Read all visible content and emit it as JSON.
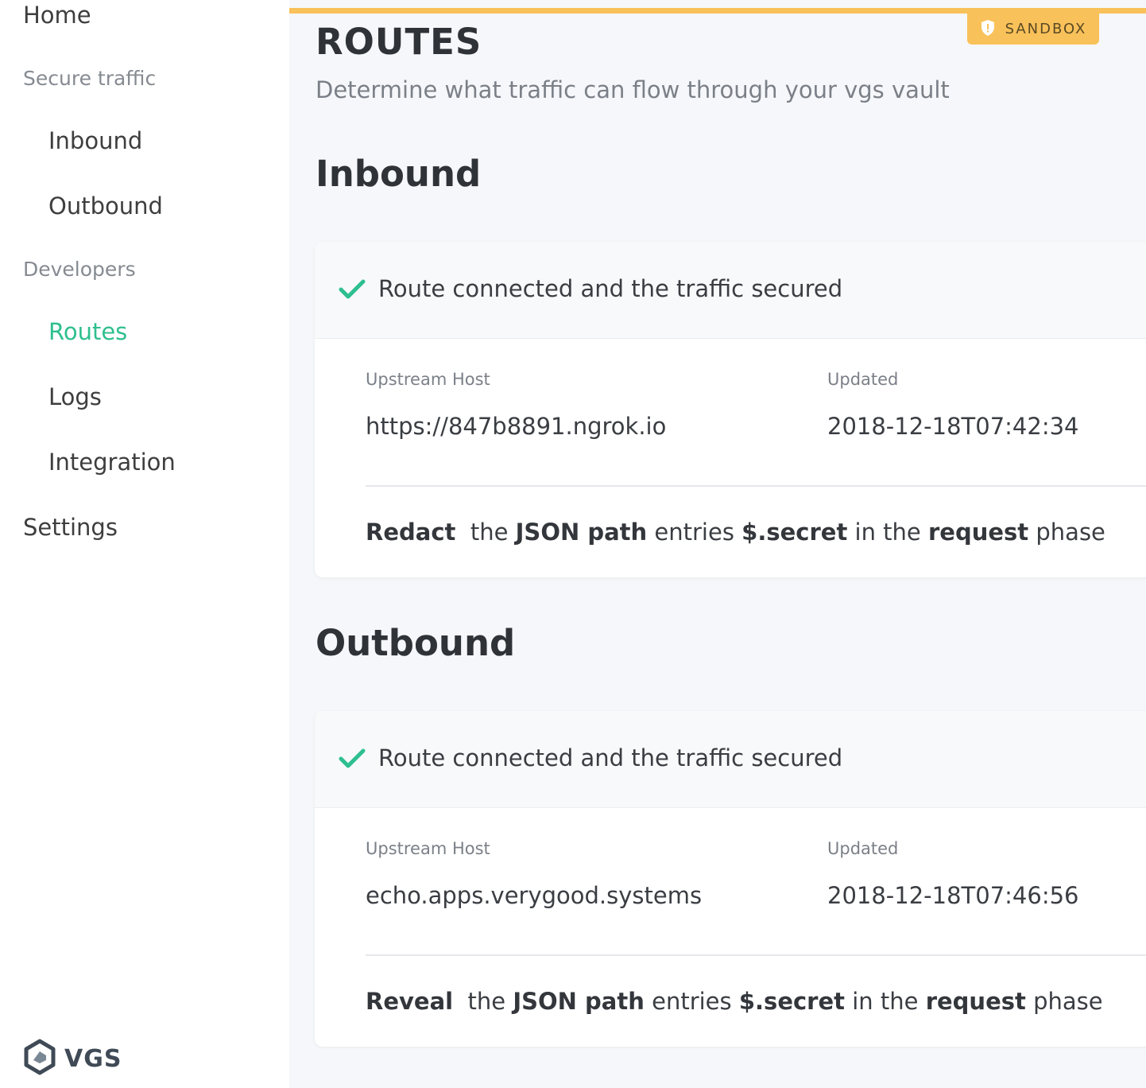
{
  "sidebar": {
    "items": [
      {
        "label": "Home"
      },
      {
        "label": "Secure traffic"
      },
      {
        "label": "Inbound"
      },
      {
        "label": "Outbound"
      },
      {
        "label": "Developers"
      },
      {
        "label": "Routes"
      },
      {
        "label": "Logs"
      },
      {
        "label": "Integration"
      },
      {
        "label": "Settings"
      }
    ],
    "logo_text": "VGS"
  },
  "header": {
    "badge": "SANDBOX",
    "title": "ROUTES",
    "subtitle": "Determine what traffic can flow through your vgs vault"
  },
  "sections": [
    {
      "heading": "Inbound",
      "status": "Route connected and the traffic secured",
      "host_label": "Upstream Host",
      "host_value": "https://847b8891.ngrok.io",
      "updated_label": "Updated",
      "updated_value": "2018-12-18T07:42:34",
      "rule": {
        "action": "Redact",
        "t1": "the",
        "filter": "JSON path",
        "t2": "entries",
        "path": "$.secret",
        "t3": "in the",
        "phase": "request",
        "t4": "phase"
      }
    },
    {
      "heading": "Outbound",
      "status": "Route connected and the traffic secured",
      "host_label": "Upstream Host",
      "host_value": "echo.apps.verygood.systems",
      "updated_label": "Updated",
      "updated_value": "2018-12-18T07:46:56",
      "rule": {
        "action": "Reveal",
        "t1": "the",
        "filter": "JSON path",
        "t2": "entries",
        "path": "$.secret",
        "t3": "in the",
        "phase": "request",
        "t4": "phase"
      }
    }
  ],
  "colors": {
    "accent": "#2fbf8f",
    "sandbox": "#f9c15a",
    "background": "#f6f7fa"
  },
  "icons": {
    "check": "check-icon",
    "shield": "shield-icon",
    "logo": "vgs-logo-icon"
  }
}
